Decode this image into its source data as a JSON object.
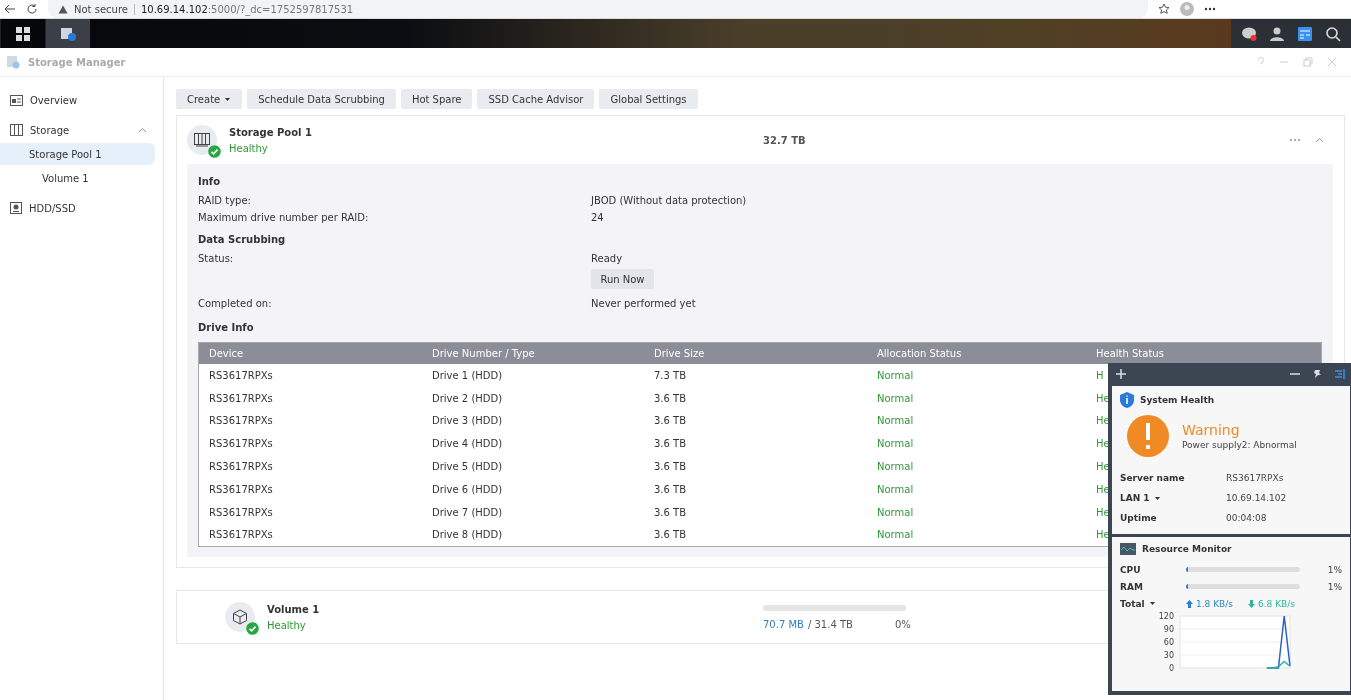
{
  "browser": {
    "security": "Not secure",
    "url_host": "10.69.14.102",
    "url_path": ":5000/?_dc=1752597817531"
  },
  "window": {
    "title": "Storage Manager"
  },
  "sidebar": {
    "items": [
      {
        "label": "Overview",
        "kind": "overview",
        "selected": false
      },
      {
        "label": "Storage",
        "kind": "storage",
        "selected": false,
        "expanded": true,
        "children": [
          {
            "label": "Storage Pool 1",
            "selected": true,
            "children": [
              {
                "label": "Volume 1",
                "selected": false
              }
            ]
          }
        ]
      },
      {
        "label": "HDD/SSD",
        "kind": "disk",
        "selected": false
      }
    ]
  },
  "toolbar": [
    {
      "label": "Create",
      "kind": "dropdown"
    },
    {
      "label": "Schedule Data Scrubbing",
      "kind": "button"
    },
    {
      "label": "Hot Spare",
      "kind": "button"
    },
    {
      "label": "SSD Cache Advisor",
      "kind": "button"
    },
    {
      "label": "Global Settings",
      "kind": "button"
    }
  ],
  "pool": {
    "name": "Storage Pool 1",
    "status": "Healthy",
    "capacity": "32.7 TB",
    "expanded": true,
    "info_title": "Info",
    "info": [
      {
        "label": "RAID type:",
        "value": "JBOD (Without data protection)"
      },
      {
        "label": "Maximum drive number per RAID:",
        "value": "24"
      }
    ],
    "scrub_title": "Data Scrubbing",
    "scrub_label": "Status:",
    "scrub_value": "Ready",
    "run_button": "Run Now",
    "completed_label": "Completed on:",
    "completed_value": "Never performed yet",
    "drive_title": "Drive Info",
    "table": {
      "columns": [
        "Device",
        "Drive Number / Type",
        "Drive Size",
        "Allocation Status",
        "Health Status"
      ],
      "rows": [
        [
          "RS3617RPXs",
          "Drive 1 (HDD)",
          "7.3 TB",
          "Normal",
          "H"
        ],
        [
          "RS3617RPXs",
          "Drive 2 (HDD)",
          "3.6 TB",
          "Normal",
          "He"
        ],
        [
          "RS3617RPXs",
          "Drive 3 (HDD)",
          "3.6 TB",
          "Normal",
          "He"
        ],
        [
          "RS3617RPXs",
          "Drive 4 (HDD)",
          "3.6 TB",
          "Normal",
          "He"
        ],
        [
          "RS3617RPXs",
          "Drive 5 (HDD)",
          "3.6 TB",
          "Normal",
          "He"
        ],
        [
          "RS3617RPXs",
          "Drive 6 (HDD)",
          "3.6 TB",
          "Normal",
          "He"
        ],
        [
          "RS3617RPXs",
          "Drive 7 (HDD)",
          "3.6 TB",
          "Normal",
          "He"
        ],
        [
          "RS3617RPXs",
          "Drive 8 (HDD)",
          "3.6 TB",
          "Normal",
          "He"
        ]
      ]
    }
  },
  "volume": {
    "name": "Volume 1",
    "status": "Healthy",
    "used": "70.7 MB",
    "total": "/ 31.4 TB",
    "percent": "0%",
    "level": 0.0
  },
  "widget": {
    "health": {
      "title": "System Health",
      "status": "Warning",
      "message": "Power supply2: Abnormal",
      "rows": [
        {
          "label": "Server name",
          "value": "RS3617RPXs",
          "dropdown": false
        },
        {
          "label": "LAN 1",
          "value": "10.69.14.102",
          "dropdown": true
        },
        {
          "label": "Uptime",
          "value": "00:04:08",
          "dropdown": false
        }
      ]
    },
    "resource": {
      "title": "Resource Monitor",
      "meters": [
        {
          "label": "CPU",
          "level": 0.01,
          "reading": "1%"
        },
        {
          "label": "RAM",
          "level": 0.01,
          "reading": "1%"
        }
      ],
      "total": {
        "label": "Total",
        "up": "1.8 KB/s",
        "down": "6.8 KB/s"
      },
      "chart_data": {
        "type": "line",
        "grid": true,
        "ylim": [
          0,
          120
        ],
        "yticks": [
          0,
          30,
          60,
          90,
          120
        ],
        "series": [
          {
            "color": "#2a62c8",
            "values": [
              null,
              null,
              null,
              null,
              null,
              null,
              null,
              null,
              null,
              null,
              null,
              null,
              null,
              null,
              null,
              0,
              0,
              0,
              120,
              5
            ]
          },
          {
            "color": "#2fb5a0",
            "values": [
              null,
              null,
              null,
              null,
              null,
              null,
              null,
              null,
              null,
              null,
              null,
              null,
              null,
              null,
              null,
              0,
              0,
              3,
              15,
              4
            ]
          }
        ]
      }
    }
  }
}
